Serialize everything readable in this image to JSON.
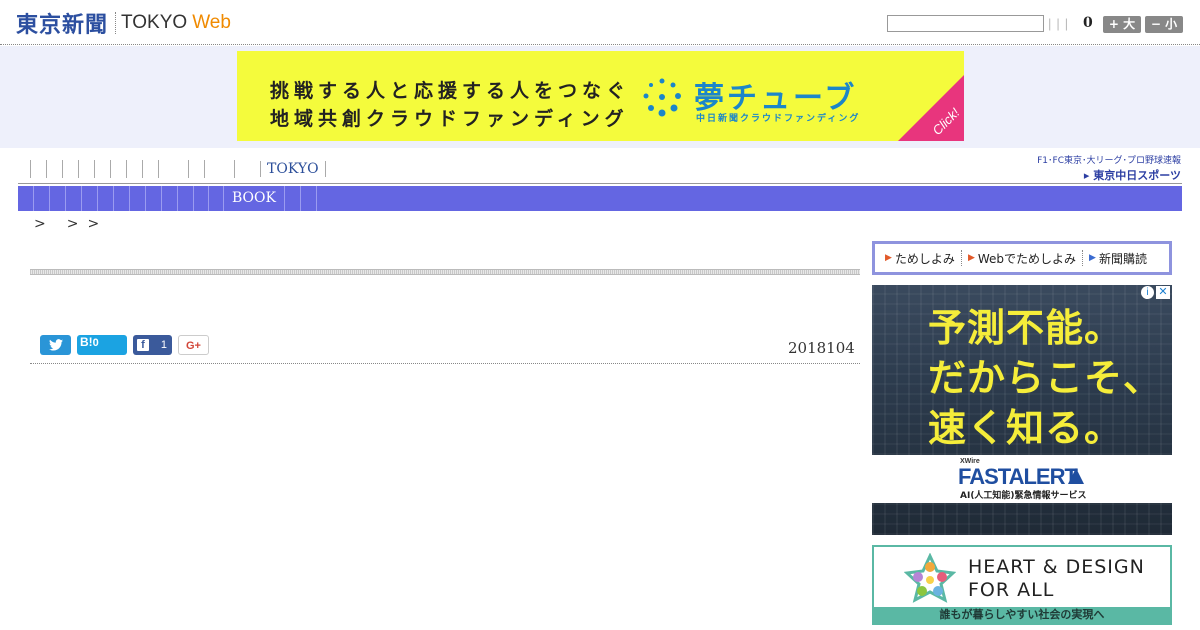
{
  "header": {
    "logo_jp": "東京新聞",
    "logo_en": "TOKYO",
    "logo_web": "Web",
    "search_placeholder": "",
    "font_size_value": "0",
    "font_larger_label": "+ 大",
    "font_smaller_label": "− 小"
  },
  "banner": {
    "line1": "挑戦する人と応援する人をつなぐ",
    "line2": "地域共創クラウドファンディング",
    "brand": "夢チューブ",
    "brand_sub": "中日新聞クラウドファンディング",
    "click_label": "Click!"
  },
  "nav": {
    "tokyo_label": "TOKYO",
    "book_label": "BOOK",
    "sports_top": "F1･FC東京･大リーグ･プロ野球速報",
    "sports_bottom": "東京中日スポーツ"
  },
  "breadcrumb": [
    ">",
    ">",
    ">"
  ],
  "article": {
    "date": "2018104",
    "share": {
      "twitter_icon": "twitter-icon",
      "hatena_label": "B!",
      "hatena_count": "0",
      "facebook_icon": "facebook-icon",
      "facebook_count": "1",
      "gplus_label": "G+"
    }
  },
  "sidebar": {
    "trial_links": [
      {
        "label": "ためしよみ"
      },
      {
        "label": "Webでためしよみ"
      },
      {
        "label": "新聞購読"
      }
    ],
    "ad1": {
      "line1": "予測不能。",
      "line2": "だからこそ、",
      "line3": "速く知る。",
      "xwire": "XWire",
      "product": "FASTALERT",
      "sub": "AI(人工知能)緊急情報サービス",
      "info_icon": "info-icon",
      "close_icon": "close-icon"
    },
    "ad2": {
      "title1": "HEART & DESIGN",
      "title2": "FOR ALL",
      "strip": "誰もが暮らしやすい社会の実現へ"
    }
  },
  "colors": {
    "brand_blue": "#2c4fa0",
    "web_orange": "#f08a00",
    "nav_bar": "#6466e2",
    "banner_yellow": "#f4fb3c",
    "banner_pink": "#e8357d",
    "ad_yellow": "#f5ed3a",
    "ad2_teal": "#5ab8a4"
  }
}
